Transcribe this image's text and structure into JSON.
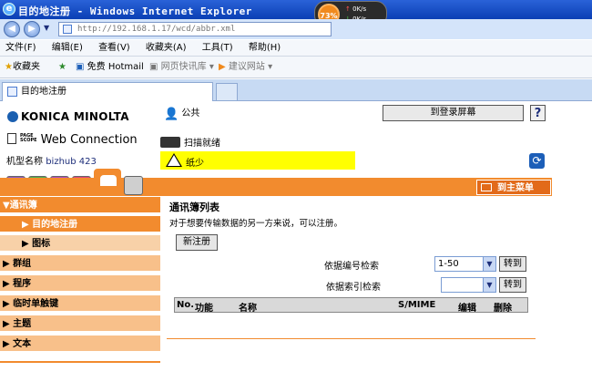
{
  "window": {
    "title": "目的地注册 - Windows Internet Explorer",
    "speed_pct": "73%",
    "speed_up": "0K/s",
    "speed_down": "0K/s"
  },
  "address": {
    "url": "http://192.168.1.17/wcd/abbr.xml"
  },
  "menu": [
    "文件(F)",
    "编辑(E)",
    "查看(V)",
    "收藏夹(A)",
    "工具(T)",
    "帮助(H)"
  ],
  "favorites": {
    "fav_label": "收藏夹",
    "hotmail": "免费 Hotmail",
    "gallery": "网页快讯库",
    "suggest": "建议网站"
  },
  "tab": {
    "label": "目的地注册"
  },
  "header": {
    "brand": "KONICA MINOLTA",
    "page_scope_1": "PAGE",
    "page_scope_2": "SCOPE",
    "product": "Web Connection",
    "model_label": "机型名称",
    "model_value": "bizhub 423",
    "user": "公共",
    "login_button": "到登录屏幕",
    "help_button": "?",
    "scan_status": "扫描就绪",
    "warning": "纸少",
    "main_menu": "到主菜单"
  },
  "sidebar": {
    "addressbook": "▼通讯簿",
    "dest_reg": "▶ 目的地注册",
    "icon": "▶ 图标",
    "group": "▶ 群组",
    "program": "▶ 程序",
    "temp": "▶ 临时单触键",
    "subject": "▶ 主题",
    "text": "▶ 文本"
  },
  "main": {
    "title": "通讯簿列表",
    "desc": "对于想要传输数据的另一方来说，可以注册。",
    "new_button": "新注册",
    "search_num_label": "依据编号检索",
    "search_num_value": "1-50",
    "search_idx_label": "依据索引检索",
    "search_idx_value": "",
    "go_button": "转到",
    "go_button2": "转到",
    "columns": [
      "No.",
      "功能",
      "名称",
      "S/MIME",
      "编辑",
      "删除"
    ]
  },
  "colors": {
    "accent": "#f28b2e",
    "titlebar": "#0a3fb4",
    "warning": "#ffff00"
  }
}
